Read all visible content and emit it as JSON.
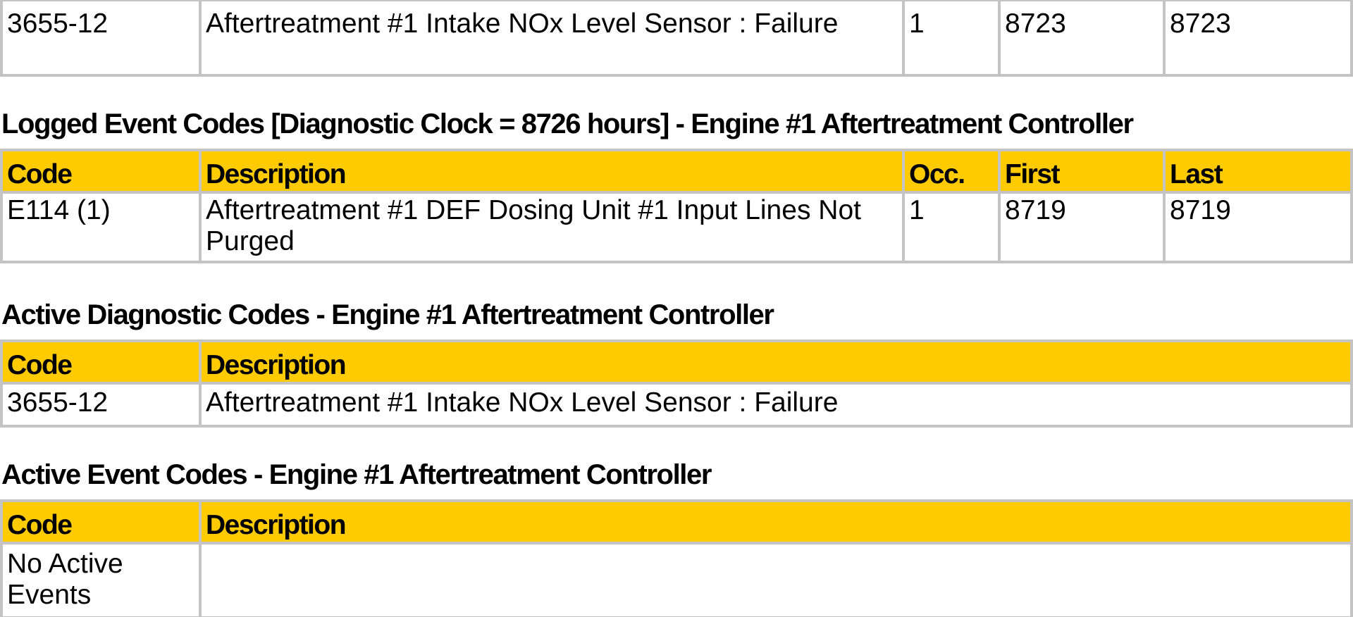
{
  "colors": {
    "header_bg": "#fecb00",
    "border": "#c4c4c4",
    "text": "#000000"
  },
  "previous_table": {
    "rows": [
      {
        "code": "3655-12",
        "description": "Aftertreatment #1 Intake NOx Level Sensor : Failure",
        "occ": "1",
        "first": "8723",
        "last": "8723"
      }
    ]
  },
  "logged_event_codes": {
    "title": "Logged Event Codes [Diagnostic Clock = 8726 hours] - Engine #1 Aftertreatment Controller",
    "columns": [
      "Code",
      "Description",
      "Occ.",
      "First",
      "Last"
    ],
    "rows": [
      {
        "code": "E114 (1)",
        "description": "Aftertreatment #1 DEF Dosing Unit #1 Input Lines Not Purged",
        "occ": "1",
        "first": "8719",
        "last": "8719"
      }
    ]
  },
  "active_diagnostic_codes": {
    "title": "Active Diagnostic Codes - Engine #1 Aftertreatment Controller",
    "columns": [
      "Code",
      "Description"
    ],
    "rows": [
      {
        "code": "3655-12",
        "description": "Aftertreatment #1 Intake NOx Level Sensor : Failure"
      }
    ]
  },
  "active_event_codes": {
    "title": "Active Event Codes - Engine #1 Aftertreatment Controller",
    "columns": [
      "Code",
      "Description"
    ],
    "rows": [
      {
        "code": "No Active Events",
        "description": ""
      }
    ]
  }
}
